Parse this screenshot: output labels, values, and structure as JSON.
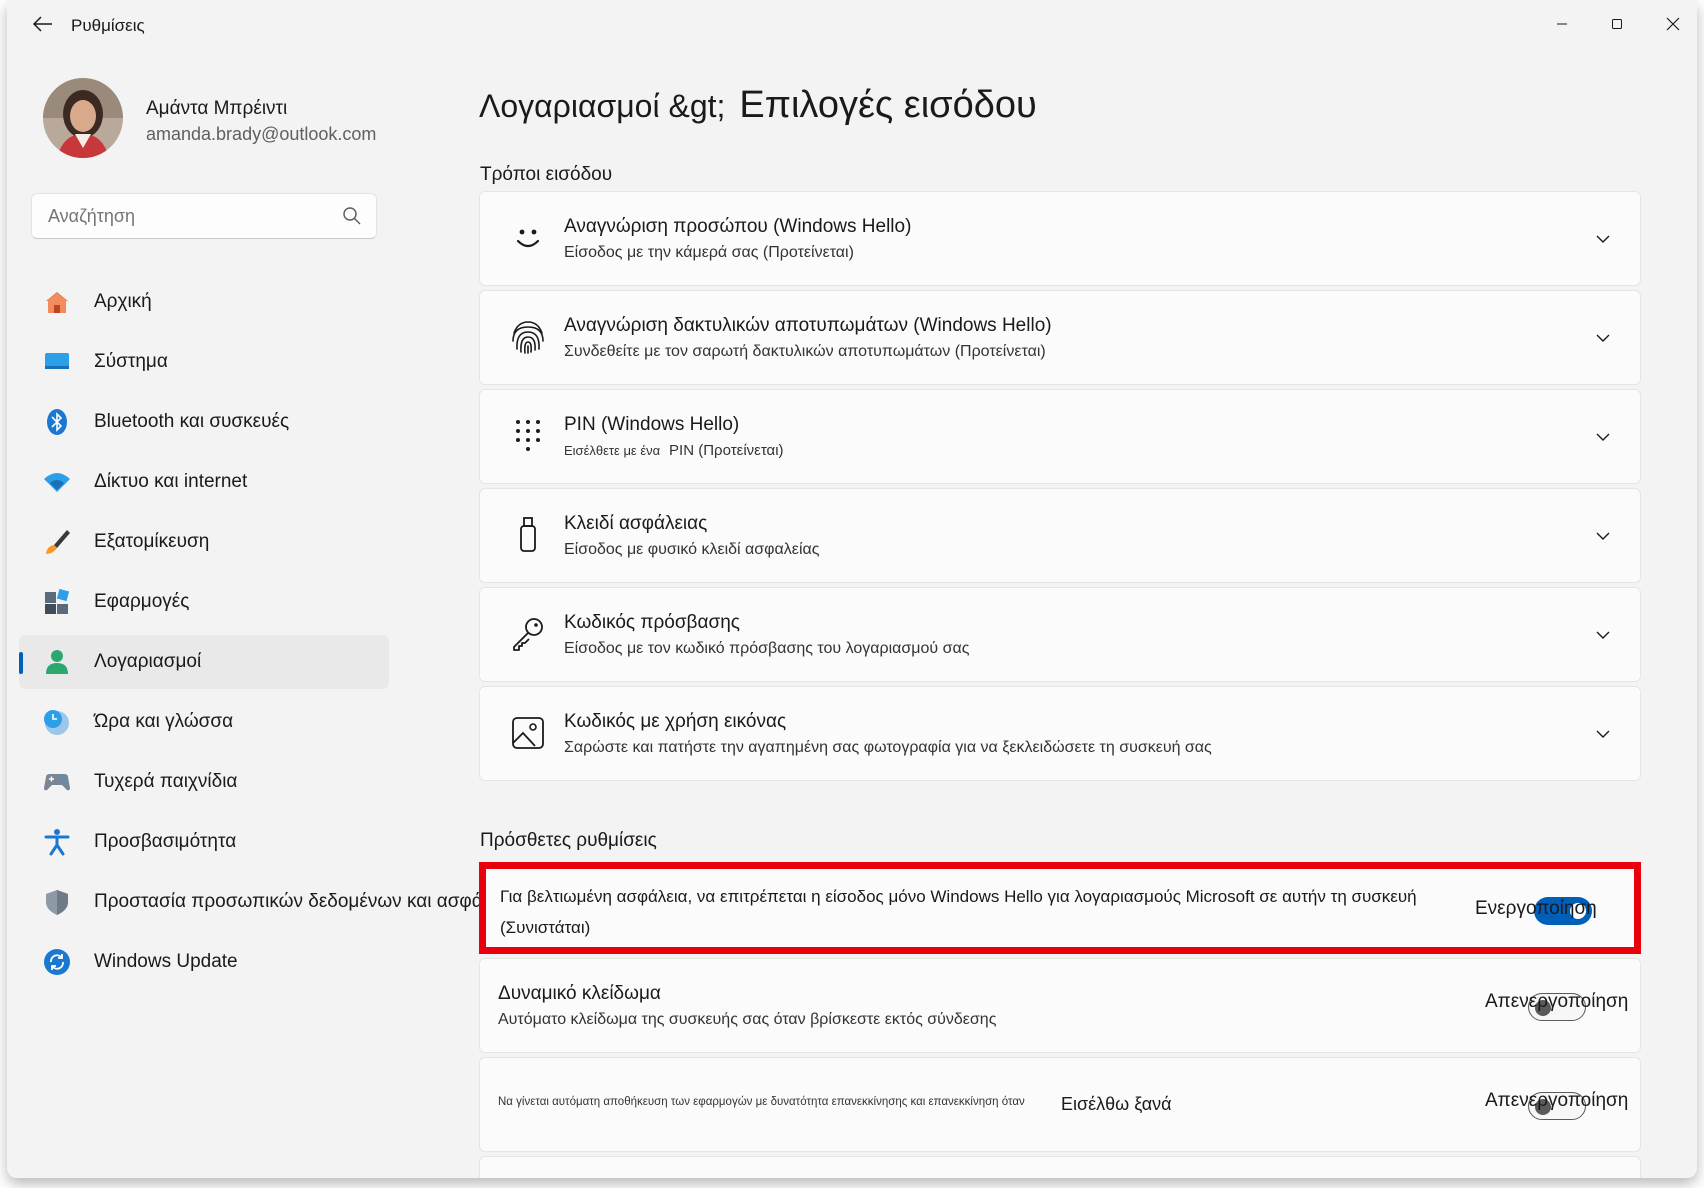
{
  "window": {
    "app_title": "Ρυθμίσεις"
  },
  "profile": {
    "name": "Αμάντα Μπρέιντι",
    "email": "amanda.brady@outlook.com"
  },
  "search": {
    "placeholder": "Αναζήτηση"
  },
  "nav": {
    "items": [
      {
        "label": "Αρχική",
        "icon": "home-icon"
      },
      {
        "label": "Σύστημα",
        "icon": "system-icon"
      },
      {
        "label": "Bluetooth και συσκευές",
        "icon": "bluetooth-icon"
      },
      {
        "label": "Δίκτυο και internet",
        "icon": "wifi-icon"
      },
      {
        "label": "Εξατομίκευση",
        "icon": "brush-icon"
      },
      {
        "label": "Εφαρμογές",
        "icon": "apps-icon"
      },
      {
        "label": "Λογαριασμοί",
        "icon": "accounts-icon",
        "selected": true
      },
      {
        "label": "Ώρα και γλώσσα",
        "icon": "time-language-icon"
      },
      {
        "label": "Τυχερά παιχνίδια",
        "icon": "gamepad-icon"
      },
      {
        "label": "Προσβασιμότητα",
        "icon": "accessibility-icon"
      },
      {
        "label": "Προστασία προσωπικών δεδομένων και ασφάλεια",
        "icon": "shield-icon"
      },
      {
        "label": "Windows Update",
        "icon": "update-icon"
      }
    ]
  },
  "main": {
    "breadcrumb_parent": "Λογαριασμοί &gt;",
    "breadcrumb_current": "Επιλογές εισόδου",
    "ways_title": "Τρόποι εισόδου",
    "sign_in_options": [
      {
        "title": "Αναγνώριση προσώπου (Windows Hello)",
        "subtitle": "Είσοδος με την κάμερά σας (Προτείνεται)",
        "icon": "face-icon"
      },
      {
        "title": "Αναγνώριση δακτυλικών αποτυπωμάτων (Windows Hello)",
        "subtitle": "Συνδεθείτε με τον σαρωτή δακτυλικών αποτυπωμάτων (Προτείνεται)",
        "icon": "fingerprint-icon"
      },
      {
        "title": "PIN (Windows Hello)",
        "subtitle_part1": "Εισέλθετε με ένα",
        "subtitle_part2": "PIN (Προτείνεται)",
        "icon": "pin-keypad-icon"
      },
      {
        "title": "Κλειδί ασφάλειας",
        "subtitle": "Είσοδος με φυσικό κλειδί ασφαλείας",
        "icon": "usb-key-icon"
      },
      {
        "title": "Κωδικός πρόσβασης",
        "subtitle": "Είσοδος με τον κωδικό πρόσβασης του λογαριασμού σας",
        "icon": "key-icon"
      },
      {
        "title": "Κωδικός με χρήση εικόνας",
        "subtitle": "Σαρώστε και πατήστε την αγαπημένη σας φωτογραφία για να ξεκλειδώσετε τη συσκευή σας",
        "icon": "picture-icon"
      }
    ],
    "additional_title": "Πρόσθετες ρυθμίσεις",
    "hello_only": {
      "text": "Για βελτιωμένη ασφάλεια, να επιτρέπεται η είσοδος μόνο Windows Hello για λογαριασμούς Microsoft σε αυτήν τη συσκευή (Συνιστάται)",
      "toggle_label": "Ενεργοποίηση",
      "toggle_on": true,
      "highlight_color": "#e8000d"
    },
    "dynamic_lock": {
      "title": "Δυναμικό κλείδωμα",
      "subtitle": "Αυτόματο κλείδωμα της συσκευής σας όταν βρίσκεστε εκτός σύνδεσης",
      "toggle_label": "Απενεργοποίηση",
      "toggle_on": false
    },
    "restart_apps": {
      "text": "Να γίνεται αυτόματη αποθήκευση των εφαρμογών με δυνατότητα επανεκκίνησης και επανεκκίνηση όταν",
      "text_part2": "Εισέλθω ξανά",
      "toggle_label": "Απενεργοποίηση",
      "toggle_on": false
    }
  },
  "colors": {
    "accent": "#005fb8",
    "background": "#f3f3f3",
    "card": "#fbfbfb"
  }
}
